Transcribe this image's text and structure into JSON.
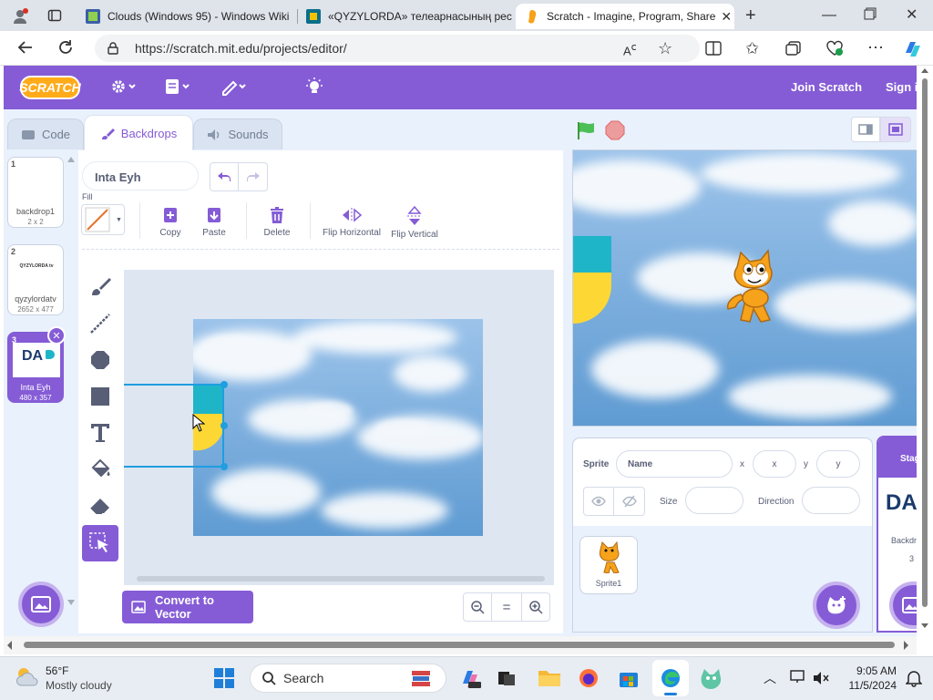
{
  "browser": {
    "tabs": [
      {
        "title": "Clouds (Windows 95) - Windows Wiki"
      },
      {
        "title": "«QYZYLORDA» телеарнасының ресми"
      },
      {
        "title": "Scratch - Imagine, Program, Share",
        "active": true
      }
    ],
    "url": "https://scratch.mit.edu/projects/editor/"
  },
  "menubar": {
    "logo": "SCRATCH",
    "join": "Join Scratch",
    "signin": "Sign in"
  },
  "editor_tabs": [
    {
      "label": "Code"
    },
    {
      "label": "Backdrops",
      "active": true
    },
    {
      "label": "Sounds"
    }
  ],
  "backdrops": [
    {
      "num": "1",
      "name": "backdrop1",
      "size": "2 x 2"
    },
    {
      "num": "2",
      "name": "qyzylordatv",
      "size": "2652 x 477",
      "thumb_text": "QYZYLORDA tv"
    },
    {
      "num": "3",
      "name": "Inta Eyh",
      "size": "480 x 357",
      "selected": true,
      "thumb_text": "DA"
    }
  ],
  "paint": {
    "costume_name": "Inta Eyh",
    "fill_label": "Fill",
    "actions": [
      "Copy",
      "Paste",
      "Delete",
      "Flip Horizontal",
      "Flip Vertical"
    ],
    "convert_label": "Convert to Vector",
    "zoom_reset": "="
  },
  "sprite_info": {
    "sprite_label": "Sprite",
    "name_placeholder": "Name",
    "x_label": "x",
    "x_placeholder": "x",
    "y_label": "y",
    "y_placeholder": "y",
    "size_label": "Size",
    "direction_label": "Direction"
  },
  "sprites": [
    {
      "name": "Sprite1"
    }
  ],
  "stage_pane": {
    "label": "Stage",
    "thumb_text": "DA",
    "backdrops_label": "Backdrops",
    "backdrops_count": "3"
  },
  "taskbar": {
    "weather_temp": "56°F",
    "weather_desc": "Mostly cloudy",
    "search": "Search",
    "time": "9:05 AM",
    "date": "11/5/2024"
  },
  "colors": {
    "scratch_purple": "#855cd6",
    "pane_bg": "#e9f1fc",
    "sky": "#6ca3d6"
  }
}
